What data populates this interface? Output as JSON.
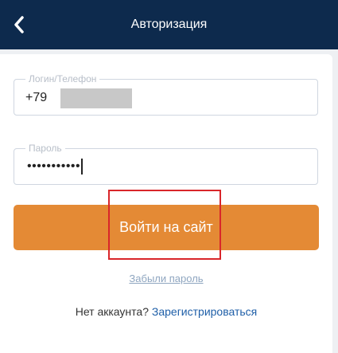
{
  "header": {
    "title": "Авторизация",
    "back_icon": "chevron-left-icon",
    "background": "#0d2a4d"
  },
  "form": {
    "login": {
      "label": "Логин/Телефон",
      "value": "+79"
    },
    "password": {
      "label": "Пароль",
      "value": "•••••••••••"
    },
    "submit_label": "Войти на сайт",
    "submit_color": "#e48a35",
    "forgot_label": "Забыли пароль"
  },
  "footer": {
    "no_account_text": "Нет аккаунта?",
    "register_label": "Зарегистрироваться"
  },
  "annotation": {
    "highlight_color": "#d9262a"
  }
}
